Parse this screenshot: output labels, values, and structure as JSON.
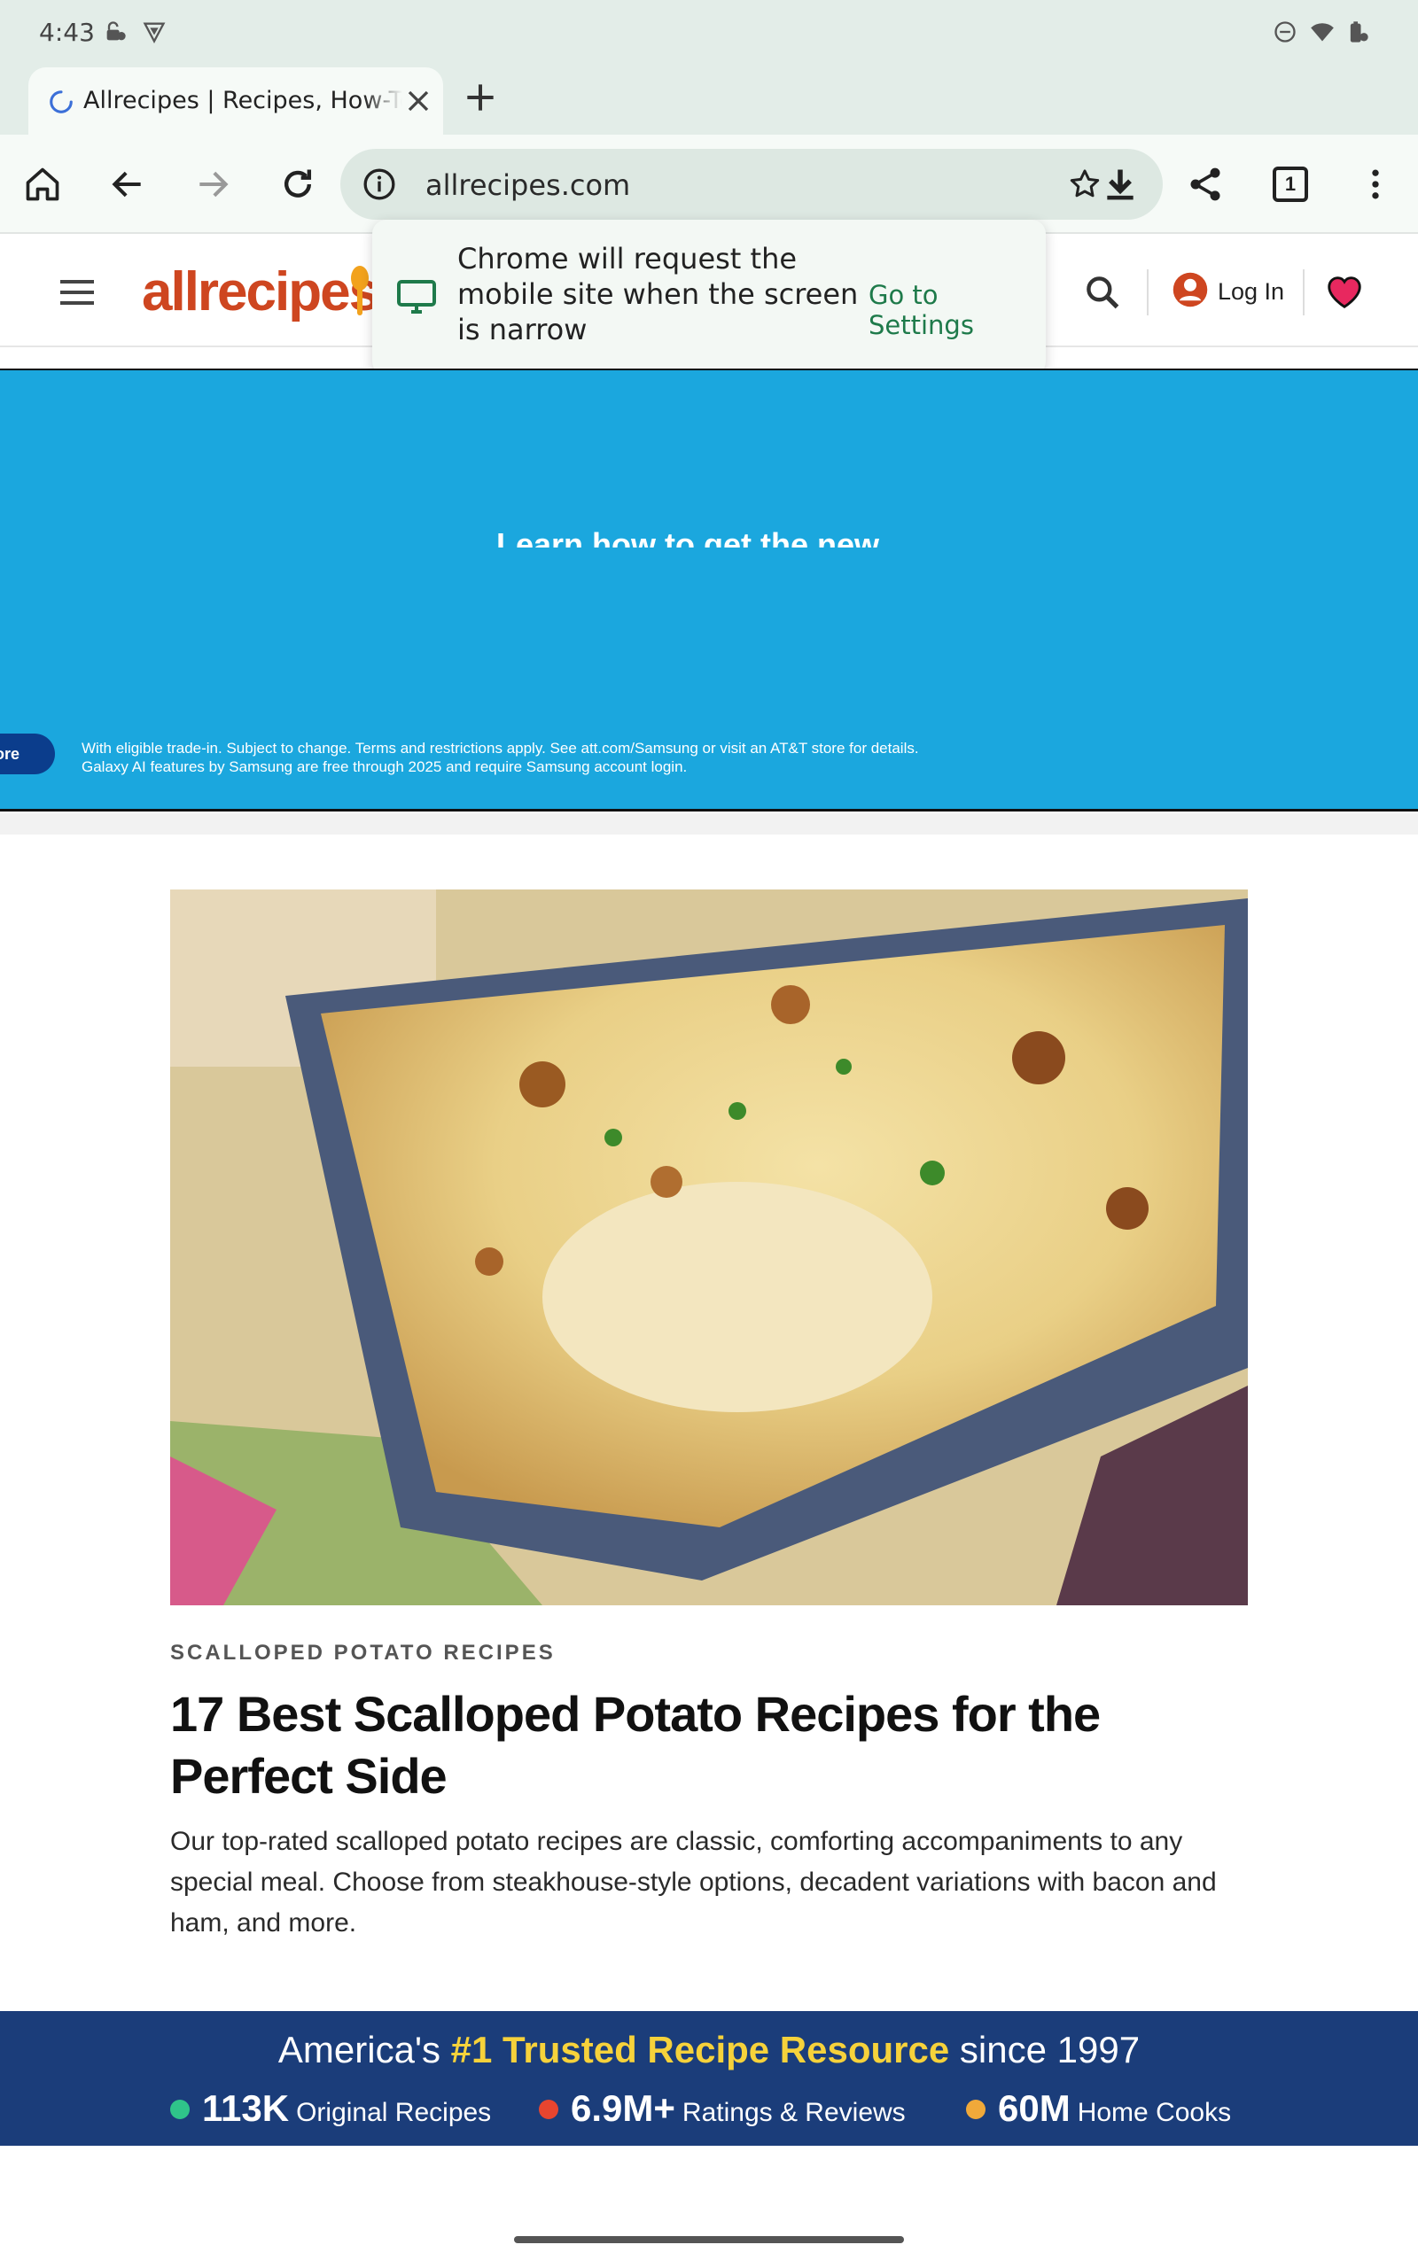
{
  "status_bar": {
    "time": "4:43",
    "icons": [
      "key-lock-icon",
      "vpn-shield-icon",
      "do-not-disturb-icon",
      "wifi-icon",
      "battery-icon"
    ]
  },
  "browser": {
    "tab": {
      "title": "Allrecipes | Recipes, How-To Videos"
    },
    "url": "allrecipes.com",
    "tab_count": "1",
    "accent_color": "#1e7a4a"
  },
  "popup": {
    "message": "Chrome will request the mobile site when the screen is narrow",
    "action_label": "Go to Settings"
  },
  "site_header": {
    "logo_text": "allrecipes",
    "login_label": "Log In",
    "brand_color": "#ce4620"
  },
  "ad": {
    "headline": "Learn how to get the new",
    "pill_label": "ore",
    "fine_print": "With eligible trade-in. Subject to change. Terms and restrictions apply. See att.com/Samsung or visit an AT&T store for details. Galaxy AI features by Samsung are free through 2025 and require Samsung account login.",
    "bg_color": "#1ba7de"
  },
  "article": {
    "kicker": "SCALLOPED POTATO RECIPES",
    "headline": "17 Best Scalloped Potato Recipes for the Perfect Side",
    "summary": "Our top-rated scalloped potato recipes are classic, comforting accompaniments to any special meal. Choose from steakhouse-style options, decadent variations with bacon and ham, and more."
  },
  "trust_banner": {
    "prefix": "America's ",
    "highlight": "#1 Trusted Recipe Resource",
    "suffix": " since 1997",
    "stats": [
      {
        "value": "113K",
        "label": "Original Recipes",
        "color": "#2fc48a"
      },
      {
        "value": "6.9M+",
        "label": "Ratings & Reviews",
        "color": "#e8452f"
      },
      {
        "value": "60M",
        "label": "Home Cooks",
        "color": "#f0a93a"
      }
    ]
  }
}
